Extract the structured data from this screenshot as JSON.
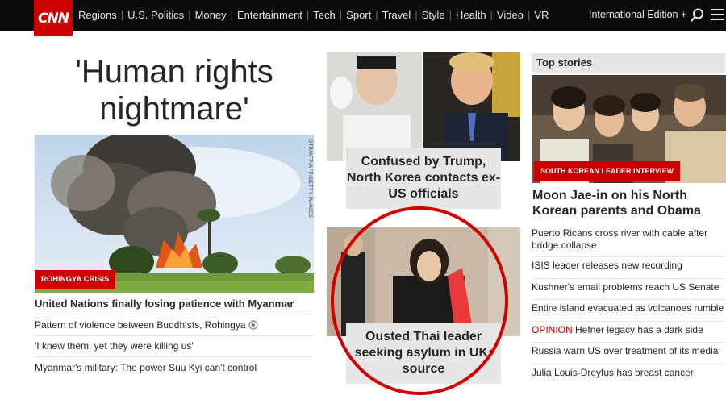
{
  "header": {
    "logo": "CNN",
    "nav_items": [
      "Regions",
      "U.S. Politics",
      "Money",
      "Entertainment",
      "Tech",
      "Sport",
      "Travel",
      "Style",
      "Health",
      "Video",
      "VR"
    ],
    "edition": "International Edition +"
  },
  "left": {
    "headline_line1": "'Human rights",
    "headline_line2": "nightmare'",
    "photo_credit": "STR/AFP/AFP/GETTY IMAGES",
    "badge": "ROHINGYA CRISIS",
    "lead": "United Nations finally losing patience with Myanmar",
    "items": [
      "Pattern of violence between Buddhists, Rohingya",
      "'I knew them, yet they were killing us'",
      "Myanmar's military: The power Suu Kyi can't control"
    ]
  },
  "middle": {
    "story1": "Confused by Trump, North Korea contacts ex-US officials",
    "story2": "Ousted Thai leader seeking asylum in UK: source"
  },
  "right": {
    "label": "Top stories",
    "badge": "SOUTH KOREAN LEADER INTERVIEW",
    "title": "Moon Jae-in on his North Korean parents and Obama",
    "items": [
      {
        "prefix": "",
        "text": "Puerto Ricans cross river with cable after bridge collapse"
      },
      {
        "prefix": "",
        "text": "ISIS leader releases new recording"
      },
      {
        "prefix": "",
        "text": "Kushner's email problems reach US Senate"
      },
      {
        "prefix": "",
        "text": "Entire island evacuated as volcanoes rumble"
      },
      {
        "prefix": "OPINION",
        "text": "Hefner legacy has a dark side"
      },
      {
        "prefix": "",
        "text": "Russia warn US over treatment of its media"
      },
      {
        "prefix": "",
        "text": "Julia Louis-Dreyfus has breast cancer"
      }
    ]
  },
  "colors": {
    "brand": "#cc0000",
    "topbar": "#0c0c0c",
    "caption_bg": "#e6e6e6"
  }
}
